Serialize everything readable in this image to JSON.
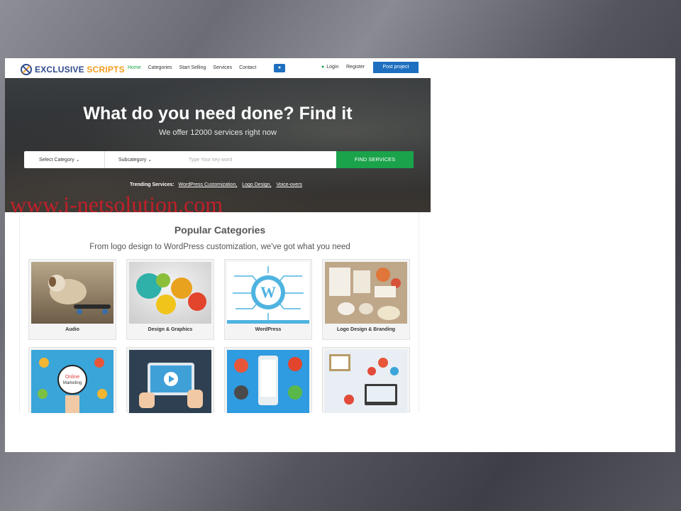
{
  "header": {
    "logo_part1": "EXCLUSIVE",
    "logo_part2": "SCRIPTS",
    "nav": [
      "Home",
      "Categories",
      "Start Selling",
      "Services",
      "Contact"
    ],
    "active_nav": "Home",
    "login": "Login",
    "register": "Register",
    "post_project": "Post project"
  },
  "hero": {
    "title": "What do you need done? Find it",
    "subtitle": "We offer 12000 services right now",
    "select_category": "Select Category",
    "subcategory": "Subcategory",
    "keyword_placeholder": "Type Your key word",
    "find_button": "FIND SERVICES",
    "trending_label": "Trending Services:",
    "trending": [
      "WordPress Customization,",
      "Logo Design,",
      "Voice-overs"
    ]
  },
  "watermark": "www.i-netsolution.com",
  "popular": {
    "title": "Popular Categories",
    "subtitle": "From logo design to WordPress customization, we've got what you need",
    "categories": [
      {
        "label": "Audio",
        "icon": "puppy-skateboard-image"
      },
      {
        "label": "Design & Graphics",
        "icon": "infographic-steps-image"
      },
      {
        "label": "WordPress",
        "icon": "wordpress-circuit-image"
      },
      {
        "label": "Logo Design & Branding",
        "icon": "branding-stationery-image"
      },
      {
        "label": "",
        "icon": "online-marketing-image"
      },
      {
        "label": "",
        "icon": "video-tablet-image"
      },
      {
        "label": "",
        "icon": "mobile-development-image"
      },
      {
        "label": "",
        "icon": "web-development-image"
      }
    ]
  },
  "colors": {
    "brand_blue": "#1e6fbf",
    "brand_green": "#1aa34a",
    "logo_orange": "#f39c1f",
    "watermark_red": "#c0202a"
  }
}
